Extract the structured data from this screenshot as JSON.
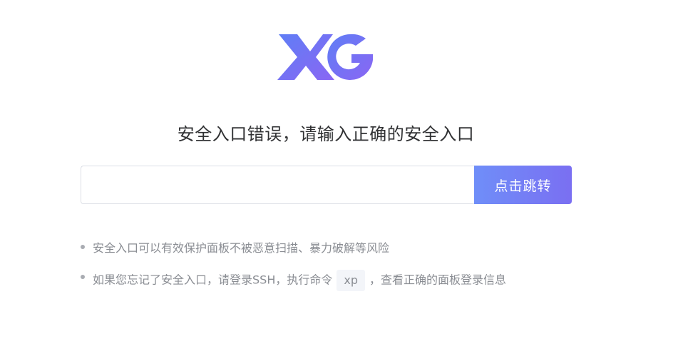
{
  "brand": {
    "logo_colors": [
      "#5f7ef5",
      "#8a66f4"
    ]
  },
  "title": "安全入口错误，请输入正确的安全入口",
  "entry": {
    "input_value": "",
    "button_label": "点击跳转"
  },
  "tips": {
    "tip1": "安全入口可以有效保护面板不被恶意扫描、暴力破解等风险",
    "tip2_before": "如果您忘记了安全入口，请登录SSH，执行命令",
    "tip2_code": "xp",
    "tip2_after": "，查看正确的面板登录信息"
  }
}
